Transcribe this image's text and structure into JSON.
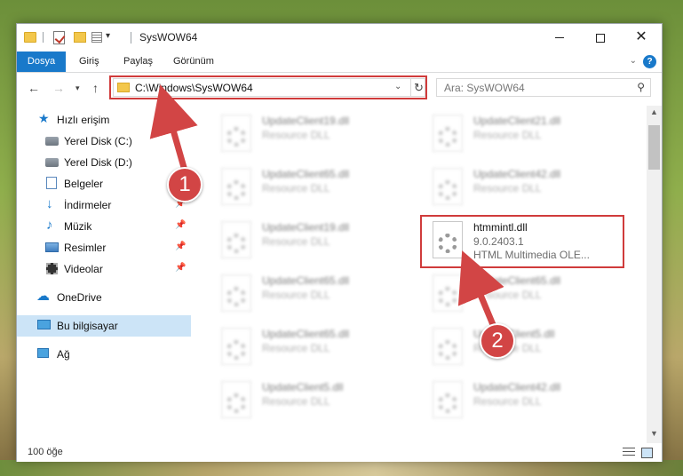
{
  "window": {
    "title": "SysWOW64"
  },
  "ribbon": {
    "tabs": [
      "Dosya",
      "Giriş",
      "Paylaş",
      "Görünüm"
    ],
    "help": "?"
  },
  "navigation": {
    "address": "C:\\Windows\\SysWOW64",
    "search_placeholder": "Ara: SysWOW64"
  },
  "sidebar": {
    "items": [
      {
        "label": "Hızlı erişim",
        "icon": "star-icon",
        "pinned": false
      },
      {
        "label": "Yerel Disk (C:)",
        "icon": "drive-icon",
        "pinned": false
      },
      {
        "label": "Yerel Disk (D:)",
        "icon": "drive-icon",
        "pinned": false
      },
      {
        "label": "Belgeler",
        "icon": "documents-icon",
        "pinned": true
      },
      {
        "label": "İndirmeler",
        "icon": "download-icon",
        "pinned": true
      },
      {
        "label": "Müzik",
        "icon": "music-icon",
        "pinned": true
      },
      {
        "label": "Resimler",
        "icon": "pictures-icon",
        "pinned": true
      },
      {
        "label": "Videolar",
        "icon": "videos-icon",
        "pinned": true
      },
      {
        "label": "OneDrive",
        "icon": "cloud-icon",
        "pinned": false
      },
      {
        "label": "Bu bilgisayar",
        "icon": "computer-icon",
        "pinned": false,
        "selected": true
      },
      {
        "label": "Ağ",
        "icon": "network-icon",
        "pinned": false
      }
    ]
  },
  "files": [
    {
      "name": "UpdateClient19.dll",
      "type": "Resource DLL"
    },
    {
      "name": "UpdateClient21.dll",
      "type": "Resource DLL"
    },
    {
      "name": "UpdateClient65.dll",
      "type": "Resource DLL"
    },
    {
      "name": "UpdateClient42.dll",
      "type": "Resource DLL"
    },
    {
      "name": "UpdateClient19.dll",
      "type": "Resource DLL"
    },
    {
      "name": "htmmintl.dll",
      "version": "9.0.2403.1",
      "description": "HTML Multimedia OLE...",
      "highlighted": true
    },
    {
      "name": "UpdateClient65.dll",
      "type": "Resource DLL"
    },
    {
      "name": "UpdateClient65.dll",
      "type": "Resource DLL"
    },
    {
      "name": "UpdateClient65.dll",
      "type": "Resource DLL"
    },
    {
      "name": "UpdateClient5.dll",
      "type": "Resource DLL"
    },
    {
      "name": "UpdateClient5.dll",
      "type": "Resource DLL"
    },
    {
      "name": "UpdateClient42.dll",
      "type": "Resource DLL"
    }
  ],
  "status": {
    "item_count": "100 öğe"
  },
  "annotations": {
    "step1": "1",
    "step2": "2",
    "highlight_color": "#d03b3b"
  }
}
